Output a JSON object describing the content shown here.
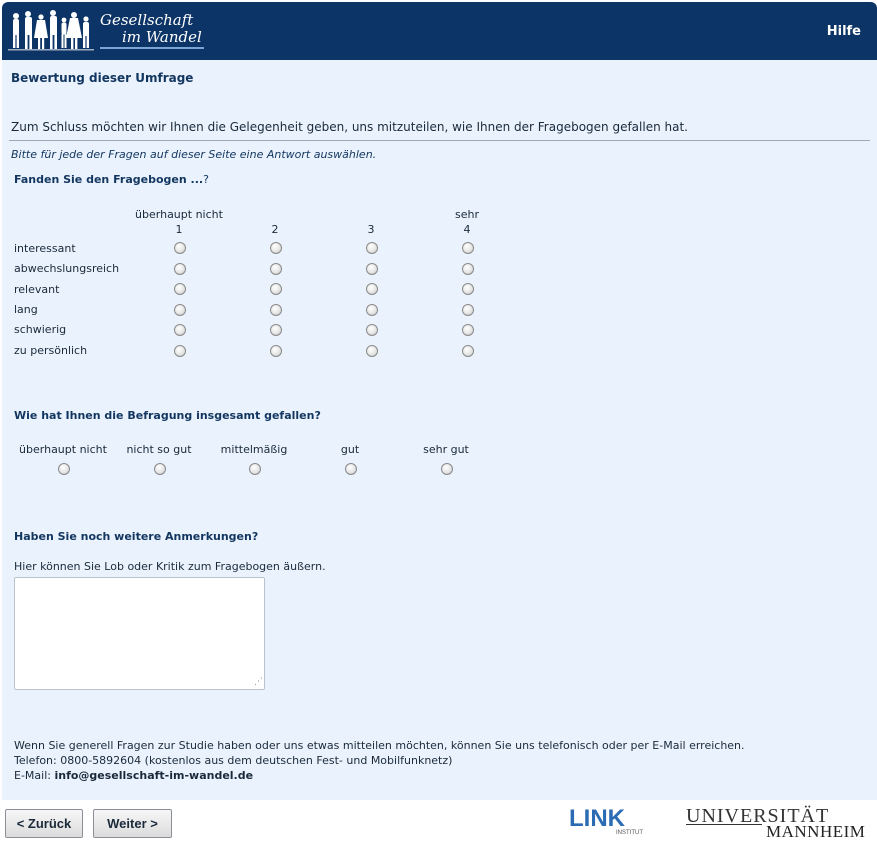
{
  "header": {
    "logo_line1": "Gesellschaft",
    "logo_line2": "im Wandel",
    "help_label": "Hilfe"
  },
  "page": {
    "title": "Bewertung dieser Umfrage",
    "intro": "Zum Schluss möchten wir Ihnen die Gelegenheit geben, uns mitzuteilen, wie Ihnen der Fragebogen gefallen hat.",
    "instruction": "Bitte für jede der Fragen auf dieser Seite eine Antwort auswählen."
  },
  "q1": {
    "title_bold": "Fanden Sie den Fragebogen ...",
    "title_rest": "?",
    "scale_low": "überhaupt nicht",
    "scale_high": "sehr",
    "scale_numbers": [
      "1",
      "2",
      "3",
      "4"
    ],
    "items": [
      "interessant",
      "abwechslungsreich",
      "relevant",
      "lang",
      "schwierig",
      "zu persönlich"
    ]
  },
  "q2": {
    "title": "Wie hat Ihnen die Befragung insgesamt gefallen?",
    "options": [
      "überhaupt nicht",
      "nicht so gut",
      "mittelmäßig",
      "gut",
      "sehr gut"
    ]
  },
  "q3": {
    "title": "Haben Sie noch weitere Anmerkungen?",
    "hint": "Hier können Sie Lob oder Kritik zum Fragebogen äußern.",
    "value": ""
  },
  "contact": {
    "line1": "Wenn Sie generell Fragen zur Studie haben oder uns etwas mitteilen möchten, können Sie uns telefonisch oder per E-Mail erreichen.",
    "line2": "Telefon: 0800-5892604 (kostenlos aus dem deutschen Fest- und Mobilfunknetz)",
    "email_label": "E-Mail: ",
    "email": "info@gesellschaft-im-wandel.de"
  },
  "nav": {
    "back_label": "< Zurück",
    "next_label": "Weiter >"
  },
  "logos": {
    "link_text": "LINK",
    "link_sub": "INSTITUT",
    "uni_line1": "UNIVERSITÄT",
    "uni_line2": "MANNHEIM"
  },
  "colors": {
    "header_bg": "#0d3466",
    "page_bg": "#eaf2fd",
    "heading_text": "#12365f",
    "link_logo_blue": "#2a6bb3"
  }
}
